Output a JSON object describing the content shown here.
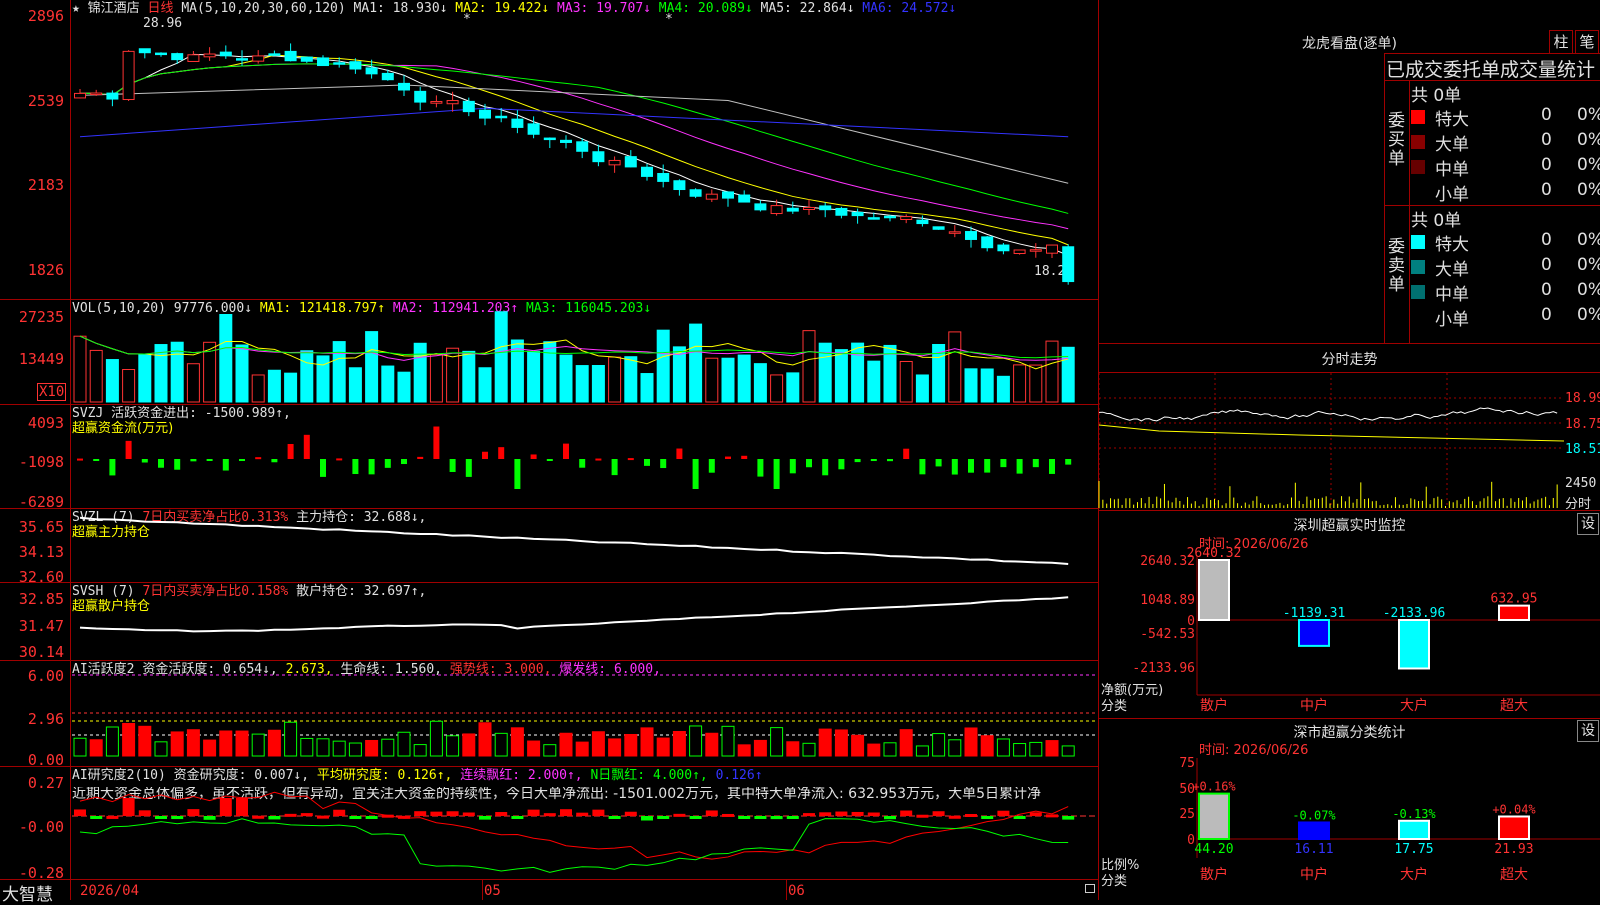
{
  "stock": {
    "name": "锦江酒店",
    "period": "日线"
  },
  "header_marks": {
    "star": "★",
    "top_marker": "*"
  },
  "ma_header": {
    "label": "MA(5,10,20,30,60,120)",
    "ma1": "MA1: 18.930↓",
    "ma2": "MA2: 19.422↓",
    "ma3": "MA3: 19.707↓",
    "ma4": "MA4: 20.089↓",
    "ma5": "MA5: 22.864↓",
    "ma6": "MA6: 24.572↓"
  },
  "price_axis": [
    "2896",
    "2539",
    "2183",
    "1826"
  ],
  "price_annotations": {
    "high": "28.96",
    "low": "18.26"
  },
  "vol_header": {
    "label": "VOL(5,10,20)",
    "value": "97776.000↓",
    "ma1": "MA1: 121418.797↑",
    "ma2": "MA2: 112941.203↑",
    "ma3": "MA3: 116045.203↓"
  },
  "vol_axis": [
    "27235",
    "13449"
  ],
  "vol_unit": "X10",
  "svzj": {
    "label": "SVZJ",
    "text": "活跃资金进出: -1500.989↑,",
    "sub": "超赢资金流(万元)"
  },
  "svzj_axis": [
    "4093",
    "-1098",
    "-6289"
  ],
  "svzl": {
    "label": "SVZL (7)",
    "ratio": "7日内买卖净占比0.313%",
    "hold": "主力持仓: 32.688↓,",
    "sub": "超赢主力持仓"
  },
  "svzl_axis": [
    "35.65",
    "34.13",
    "32.60"
  ],
  "svsh": {
    "label": "SVSH (7)",
    "ratio": "7日内买卖净占比0.158%",
    "hold": "散户持仓: 32.697↑,",
    "sub": "超赢散户持仓"
  },
  "svsh_axis": [
    "32.85",
    "31.47",
    "30.14"
  ],
  "ai1": {
    "label": "AI活跃度2",
    "a": "资金活跃度: 0.654↓,",
    "b": "2.673,",
    "c": "生命线: 1.560,",
    "d": "强势线: 3.000,",
    "e": "爆发线: 6.000,"
  },
  "ai1_axis": [
    "6.00",
    "2.96",
    "0.00"
  ],
  "ai2": {
    "label": "AI研究度2(10)",
    "a": "资金研究度: 0.007↓,",
    "b": "平均研究度: 0.126↑,",
    "c": "连续飘红: 2.000↑,",
    "d": "N日飘红: 4.000↑,",
    "e": "0.126↑"
  },
  "ai2_axis": [
    "0.27",
    "-0.00",
    "-0.28"
  ],
  "ai2_comment": "近期大资金总体偏多，虽不活跃，但有异动，宜关注大资金的持续性，今日大单净流出: -1501.002万元，其中特大单净流入: 632.953万元，大单5日累计净",
  "date_axis": {
    "brand": "大智慧",
    "d1": "2026/04",
    "d2": "05",
    "d3": "06"
  },
  "longhu": {
    "title": "龙虎看盘(逐单)",
    "btn1": "柱",
    "btn2": "笔",
    "subtitle": "已成交委托单成交量统计",
    "buy_label": "委买单",
    "buy_total": "共 0单",
    "sell_label": "委卖单",
    "sell_total": "共 0单",
    "buy_rows": [
      {
        "name": "特大",
        "v": "0",
        "p": "0%"
      },
      {
        "name": "大单",
        "v": "0",
        "p": "0%"
      },
      {
        "name": "中单",
        "v": "0",
        "p": "0%"
      },
      {
        "name": "小单",
        "v": "0",
        "p": "0%"
      }
    ],
    "sell_rows": [
      {
        "name": "特大",
        "v": "0",
        "p": "0%"
      },
      {
        "name": "大单",
        "v": "0",
        "p": "0%"
      },
      {
        "name": "中单",
        "v": "0",
        "p": "0%"
      },
      {
        "name": "小单",
        "v": "0",
        "p": "0%"
      }
    ]
  },
  "intraday": {
    "title": "分时走势",
    "axis": [
      "18.99",
      "18.75",
      "18.51"
    ],
    "vol": "2450",
    "unit": "分时"
  },
  "sz_monitor": {
    "title": "深圳超赢实时监控",
    "btn": "设",
    "time": "时间: 2026/06/26",
    "axis": [
      "2640.32",
      "1048.89",
      "0",
      "-542.53",
      "-2133.96"
    ],
    "ylabel": "净额(万元)",
    "xlabel": "分类",
    "values": [
      "2640.32",
      "-1139.31",
      "-2133.96",
      "632.95"
    ],
    "cats": [
      "散户",
      "中户",
      "大户",
      "超大"
    ]
  },
  "sz_stats": {
    "title": "深市超赢分类统计",
    "btn": "设",
    "time": "时间: 2026/06/26",
    "axis": [
      "75",
      "50",
      "25",
      "0"
    ],
    "ylabel": "比例%",
    "xlabel": "分类",
    "pcts": [
      "+0.16%",
      "-0.07%",
      "-0.13%",
      "+0.04%"
    ],
    "vals": [
      "44.20",
      "16.11",
      "17.75",
      "21.93"
    ],
    "cats": [
      "散户",
      "中户",
      "大户",
      "超大"
    ]
  },
  "chart_data": [
    {
      "type": "candlestick",
      "name": "锦江酒店 日线",
      "y_axis": [
        18.26,
        28.96
      ],
      "high": 28.96,
      "low": 18.26,
      "ma": {
        "MA1": 18.93,
        "MA2": 19.422,
        "MA3": 19.707,
        "MA4": 20.089,
        "MA5": 22.864,
        "MA6": 24.572
      },
      "colors": {
        "up": "#ff3333",
        "down": "#00ffff",
        "MA1": "#ffffff",
        "MA2": "#ffff00",
        "MA3": "#ff33ff",
        "MA4": "#00ff00",
        "MA5": "#c0c0c0",
        "MA6": "#3333ff"
      }
    },
    {
      "type": "bar",
      "name": "VOL",
      "latest": 97776.0,
      "ylim": [
        0,
        27235
      ]
    },
    {
      "type": "bar",
      "name": "SVZJ",
      "latest": -1500.989,
      "ylim": [
        -6289,
        4093
      ]
    },
    {
      "type": "line",
      "name": "SVZL",
      "latest": 32.688,
      "ylim": [
        32.6,
        35.65
      ]
    },
    {
      "type": "line",
      "name": "SVSH",
      "latest": 32.697,
      "ylim": [
        30.14,
        32.85
      ]
    },
    {
      "type": "bar",
      "name": "AI活跃度2",
      "latest": 0.654,
      "ylim": [
        0,
        6
      ]
    },
    {
      "type": "bar",
      "name": "AI研究度2",
      "latest": 0.007,
      "ylim": [
        -0.28,
        0.27
      ]
    }
  ]
}
